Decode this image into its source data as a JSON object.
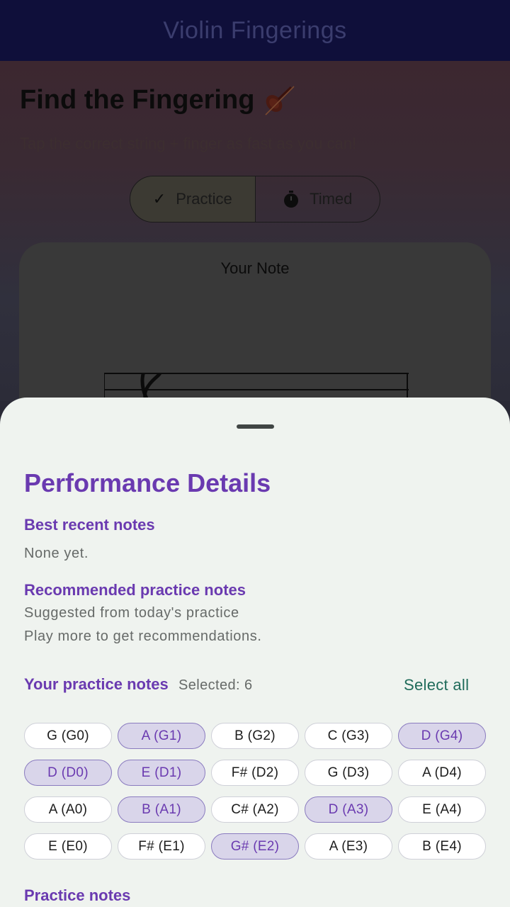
{
  "app_title": "Violin Fingerings",
  "background": {
    "heading": "Find the Fingering",
    "subtitle": "Tap the correct string + finger as fast as you can!",
    "mode_segments": [
      {
        "label": "Practice",
        "selected": true,
        "icon": "check-icon"
      },
      {
        "label": "Timed",
        "selected": false,
        "icon": "stopwatch-icon"
      }
    ],
    "note_card_title": "Your Note"
  },
  "sheet": {
    "title": "Performance Details",
    "best_recent": {
      "title": "Best recent notes",
      "text": "None yet."
    },
    "recommended": {
      "title": "Recommended practice notes",
      "subtitle": "Suggested from today's practice",
      "text": "Play more to get recommendations."
    },
    "your_notes": {
      "title": "Your practice notes",
      "selected_label": "Selected: 6",
      "select_all": "Select all",
      "chips": [
        {
          "label": "G (G0)",
          "selected": false
        },
        {
          "label": "A (G1)",
          "selected": true
        },
        {
          "label": "B (G2)",
          "selected": false
        },
        {
          "label": "C (G3)",
          "selected": false
        },
        {
          "label": "D (G4)",
          "selected": true
        },
        {
          "label": "D (D0)",
          "selected": true
        },
        {
          "label": "E (D1)",
          "selected": true
        },
        {
          "label": "F# (D2)",
          "selected": false
        },
        {
          "label": "G (D3)",
          "selected": false
        },
        {
          "label": "A (D4)",
          "selected": false
        },
        {
          "label": "A (A0)",
          "selected": false
        },
        {
          "label": "B (A1)",
          "selected": true
        },
        {
          "label": "C# (A2)",
          "selected": false
        },
        {
          "label": "D (A3)",
          "selected": true
        },
        {
          "label": "E (A4)",
          "selected": false
        },
        {
          "label": "E (E0)",
          "selected": false
        },
        {
          "label": "F# (E1)",
          "selected": false
        },
        {
          "label": "G# (E2)",
          "selected": true
        },
        {
          "label": "A (E3)",
          "selected": false
        },
        {
          "label": "B (E4)",
          "selected": false
        }
      ]
    },
    "practice_notes_title": "Practice notes"
  },
  "colors": {
    "accent_purple": "#6a3ab0",
    "select_all_green": "#1f6b5a",
    "sheet_bg": "#eff3ef",
    "appbar_bg": "#0f0f3a"
  }
}
